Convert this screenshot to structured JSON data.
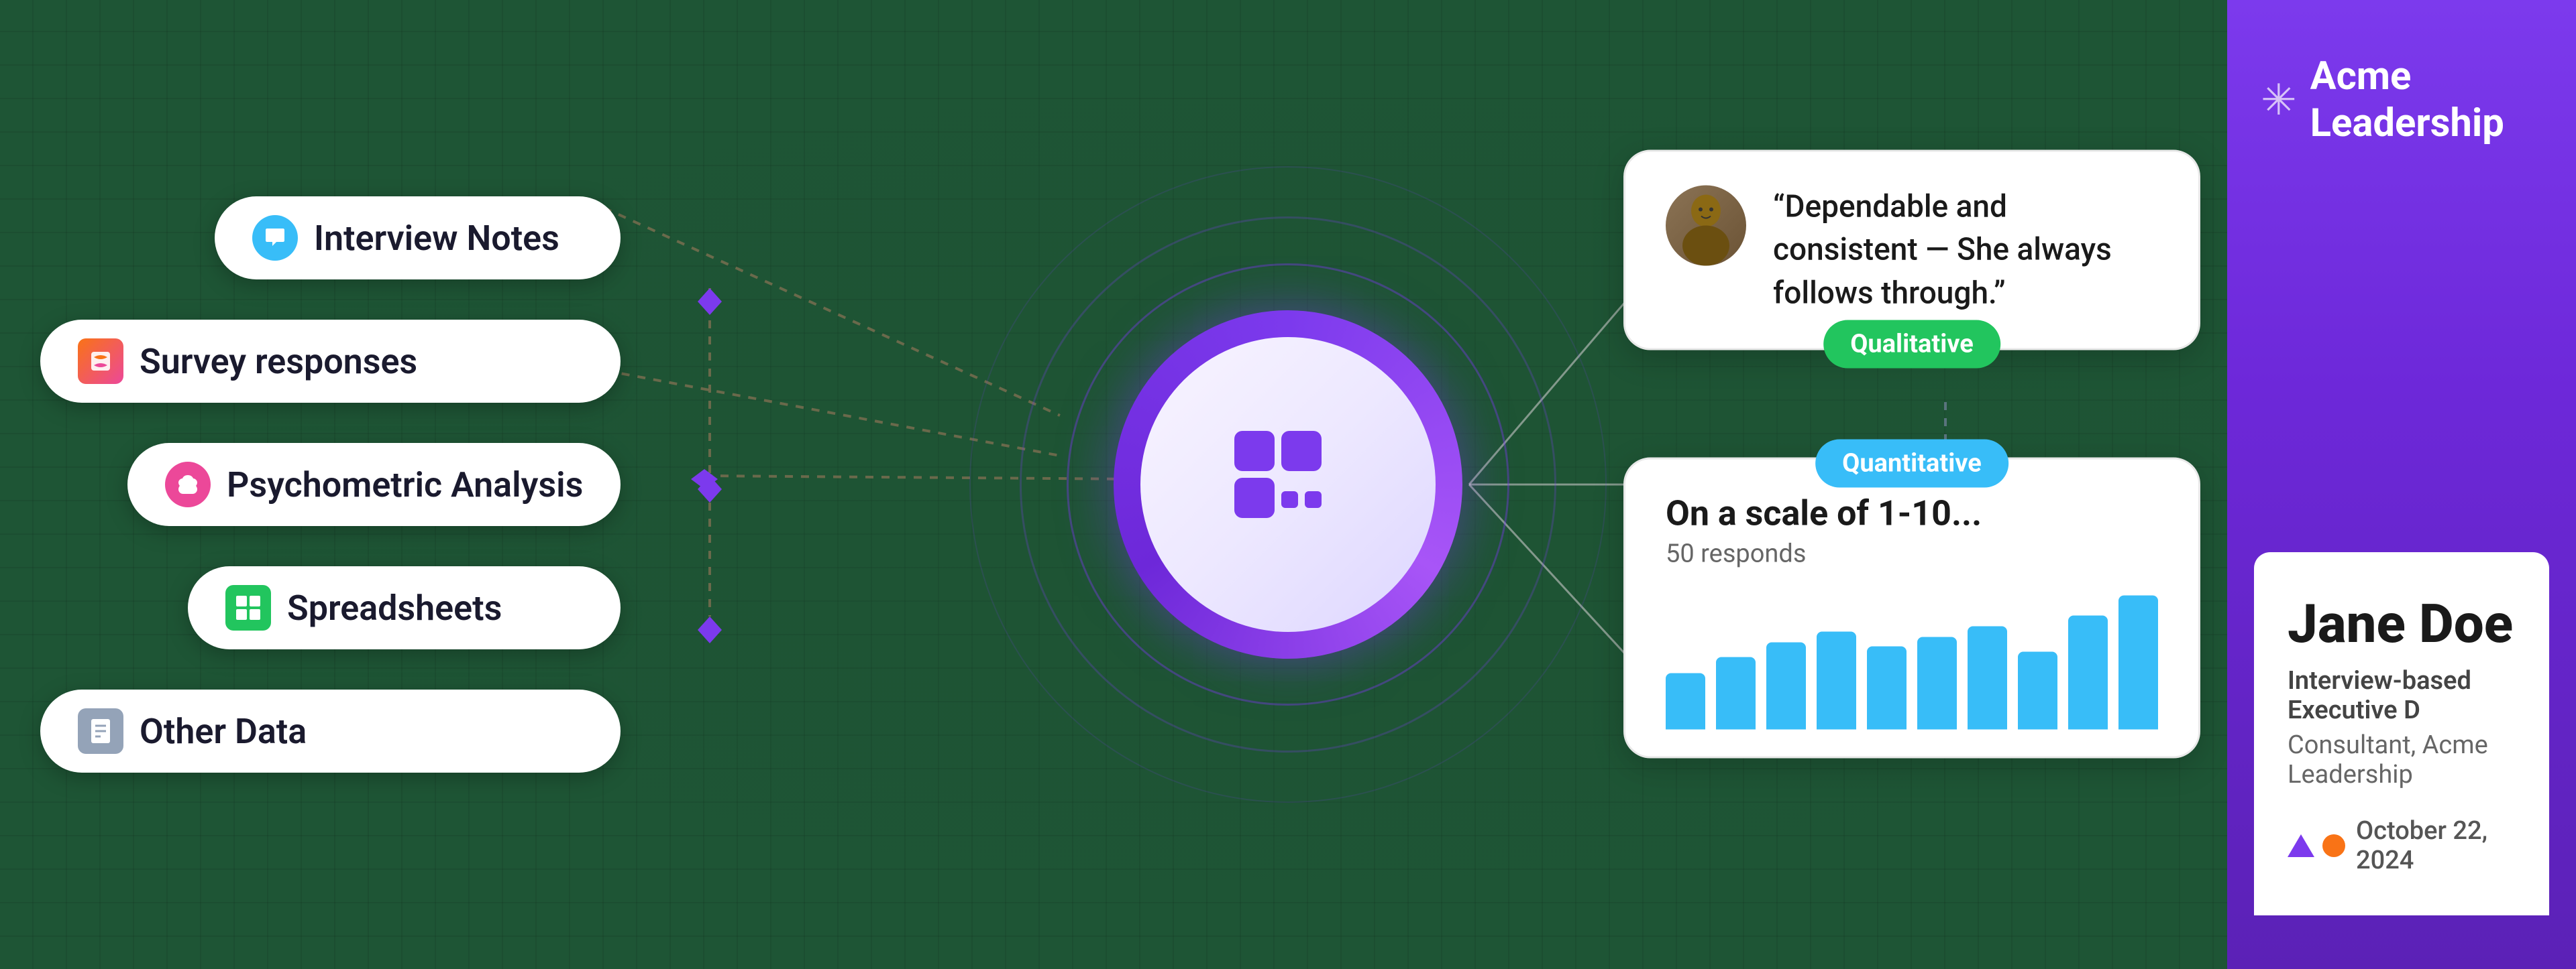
{
  "background": {
    "color": "#1e5535"
  },
  "input_sources": {
    "items": [
      {
        "id": "interview-notes",
        "label": "Interview Notes",
        "icon": "chat-icon",
        "icon_color": "#38bdf8",
        "indent": "large"
      },
      {
        "id": "survey-responses",
        "label": "Survey responses",
        "icon": "survey-icon",
        "icon_color": "#f97316",
        "indent": "none"
      },
      {
        "id": "psychometric-analysis",
        "label": "Psychometric Analysis",
        "icon": "brain-icon",
        "icon_color": "#ec4899",
        "indent": "medium"
      },
      {
        "id": "spreadsheets",
        "label": "Spreadsheets",
        "icon": "grid-icon",
        "icon_color": "#22c55e",
        "indent": "large"
      },
      {
        "id": "other-data",
        "label": "Other Data",
        "icon": "document-icon",
        "icon_color": "#94a3b8",
        "indent": "none"
      }
    ]
  },
  "center_hub": {
    "logo_alt": "AP Logo"
  },
  "qualitative_card": {
    "quote": "“Dependable and consistent — She always follows through.”",
    "badge_label": "Qualitative",
    "badge_color": "#22c55e"
  },
  "quantitative_card": {
    "title": "On a scale of 1-10...",
    "subtitle": "50 responds",
    "badge_label": "Quantitative",
    "badge_color": "#38bdf8",
    "bars": [
      55,
      70,
      85,
      95,
      80,
      90,
      100,
      75,
      110,
      130
    ]
  },
  "profile_panel": {
    "company_logo": "✷",
    "company_name": "Acme Leadership",
    "person_name": "Jane Doe",
    "role": "Interview-based Executive D",
    "company_sub": "Consultant, Acme Leadership",
    "date": "October 22, 2024"
  }
}
